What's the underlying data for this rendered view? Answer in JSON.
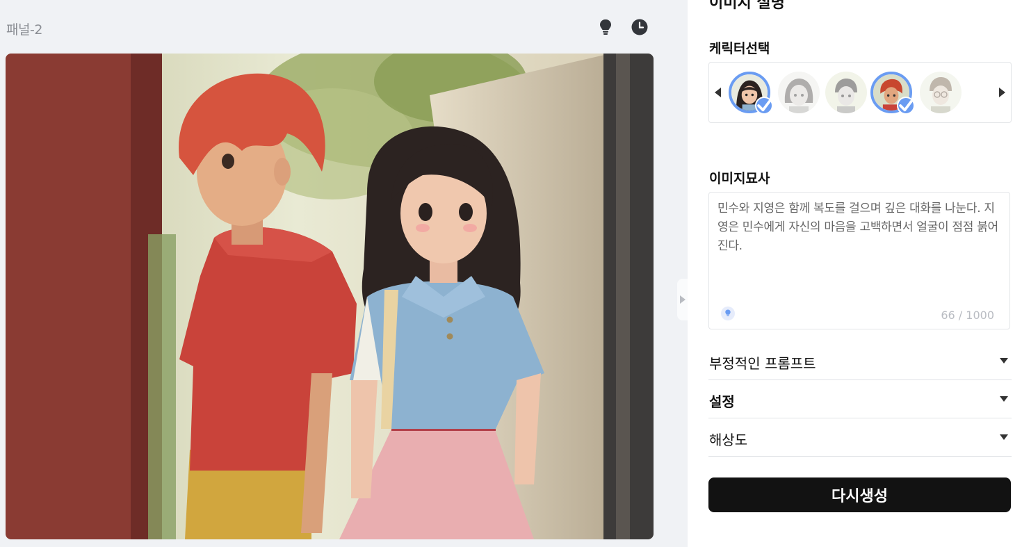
{
  "panel": {
    "title": "패널-2"
  },
  "toolbar": {
    "bulb_icon": "lightbulb-icon",
    "history_icon": "clock-icon"
  },
  "sidebar": {
    "top_title": "이미지 설명",
    "character_section": {
      "label": "케릭터선택",
      "characters": [
        {
          "name": "girl-long-hair",
          "selected": true
        },
        {
          "name": "girl-gray",
          "selected": false
        },
        {
          "name": "boy-gray",
          "selected": false
        },
        {
          "name": "boy-red-hair",
          "selected": true
        },
        {
          "name": "boy-glasses",
          "selected": false
        }
      ]
    },
    "description_section": {
      "label": "이미지묘사",
      "text": "민수와 지영은 함께 복도를 걸으며 깊은 대화를 나눈다. 지영은 민수에게 자신의 마음을 고백하면서 얼굴이 점점 붉어진다.",
      "counter": "66 / 1000"
    },
    "accordions": {
      "negative_prompt": "부정적인 프롬프트",
      "settings": "설정",
      "resolution": "해상도"
    },
    "regenerate_label": "다시생성"
  },
  "colors": {
    "accent": "#6a9cf2",
    "button_bg": "#121212",
    "left_bg": "#f0f2f5"
  }
}
